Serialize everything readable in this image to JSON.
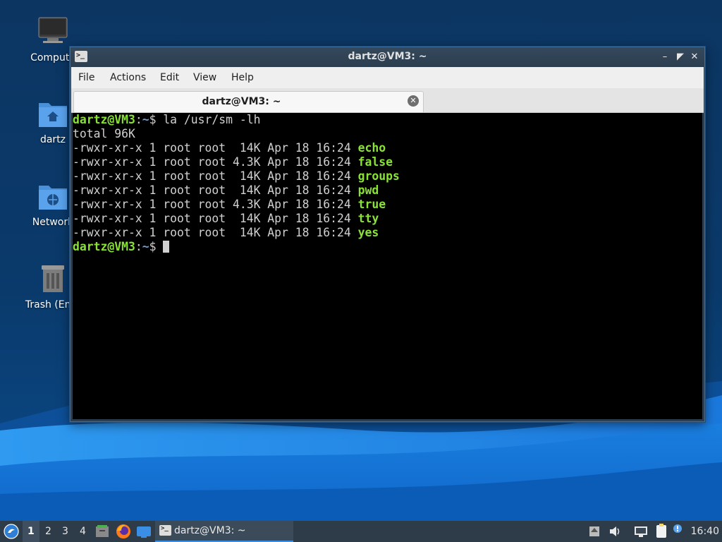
{
  "desktop": {
    "icons": [
      {
        "label": "Compute",
        "icon": "computer-icon"
      },
      {
        "label": "dartz",
        "icon": "home-folder-icon"
      },
      {
        "label": "Network",
        "icon": "network-folder-icon"
      },
      {
        "label": "Trash (Emp",
        "icon": "trash-icon"
      }
    ]
  },
  "window": {
    "title": "dartz@VM3: ~",
    "app_icon_glyph": ">_",
    "minimize_glyph": "–",
    "maximize_glyph": "◤",
    "close_glyph": "✕",
    "menu": [
      "File",
      "Actions",
      "Edit",
      "View",
      "Help"
    ],
    "tab": {
      "label": "dartz@VM3: ~",
      "close_glyph": "✕"
    }
  },
  "terminal": {
    "prompt_user": "dartz@VM3",
    "prompt_sep": ":",
    "prompt_dir": "~",
    "prompt_end": "$ ",
    "command": "la /usr/sm -lh",
    "total": "total 96K",
    "entries": [
      {
        "meta": "-rwxr-xr-x 1 root root  14K Apr 18 16:24 ",
        "name": "echo"
      },
      {
        "meta": "-rwxr-xr-x 1 root root 4.3K Apr 18 16:24 ",
        "name": "false"
      },
      {
        "meta": "-rwxr-xr-x 1 root root  14K Apr 18 16:24 ",
        "name": "groups"
      },
      {
        "meta": "-rwxr-xr-x 1 root root  14K Apr 18 16:24 ",
        "name": "pwd"
      },
      {
        "meta": "-rwxr-xr-x 1 root root 4.3K Apr 18 16:24 ",
        "name": "true"
      },
      {
        "meta": "-rwxr-xr-x 1 root root  14K Apr 18 16:24 ",
        "name": "tty"
      },
      {
        "meta": "-rwxr-xr-x 1 root root  14K Apr 18 16:24 ",
        "name": "yes"
      }
    ]
  },
  "taskbar": {
    "desktops": [
      "1",
      "2",
      "3",
      "4"
    ],
    "active_desktop": "1",
    "task_label": "dartz@VM3: ~",
    "task_icon_glyph": ">_",
    "clock": "16:40",
    "colors": {
      "accent": "#3b8ee0",
      "prompt_green": "#8ae234",
      "prompt_blue": "#729fcf"
    }
  }
}
